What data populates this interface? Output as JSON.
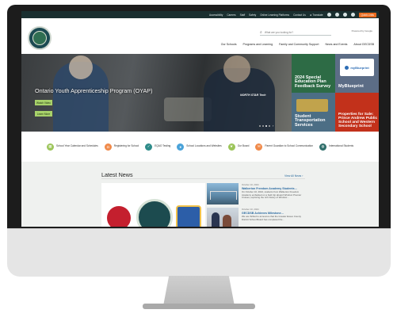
{
  "topbar": {
    "links": [
      "Accessibility",
      "Careers",
      "Staff",
      "Safety",
      "Online Learning Platforms",
      "Contact Us"
    ],
    "translate": "Translate",
    "quick_links": "Quick Links"
  },
  "header": {
    "search_placeholder": "What are you looking for?",
    "translate_by": "Powered by Google",
    "nav": [
      "Our Schools",
      "Programs and Learning",
      "Family and Community Support",
      "News and Events",
      "About GECDSB"
    ]
  },
  "hero": {
    "title": "Ontario Youth Apprenticeship Program (OYAP)",
    "buttons": [
      "Watch Video",
      "Learn More"
    ],
    "brand_text": "NORTH STAR Tech",
    "tiles": [
      {
        "label": "2024 Special Education Plan Feedback Survey",
        "color": "#2d6b45"
      },
      {
        "label": "MyBlueprint",
        "card_text": "myBlueprint",
        "color": "#5c6d86"
      },
      {
        "label": "Student Transportation Services",
        "color": "#4c6e85"
      },
      {
        "label": "Properties for Sale: Prince Andrew Public School and Western Secondary School",
        "color": "#c2311b"
      }
    ]
  },
  "quick_links": [
    {
      "label": "School Year Calendar and Schedules",
      "icon": "calendar-icon",
      "color": "#9cc55a"
    },
    {
      "label": "Registering for School",
      "icon": "backpack-icon",
      "color": "#f08a4a"
    },
    {
      "label": "EQAO Testing",
      "icon": "checklist-icon",
      "color": "#2f8c8a"
    },
    {
      "label": "School Locations and Websites",
      "icon": "map-pin-icon",
      "color": "#4aa3d9"
    },
    {
      "label": "Our Board",
      "icon": "leaf-icon",
      "color": "#9cc55a"
    },
    {
      "label": "Parent Guardian to School Communication",
      "icon": "chat-icon",
      "color": "#f08a4a"
    },
    {
      "label": "International Students",
      "icon": "globe-icon",
      "color": "#2f6e6a"
    }
  ],
  "news": {
    "title": "Latest News",
    "view_all": "View All News",
    "articles": [
      {
        "date": "October 10, 2024",
        "title": "Walkerton Freedom Academy Students…",
        "summary": "On October 10, 2024, students from Walkerton Freedom Academy embarked on a field trip aboard Windsor Premier Cruises, exploring the rich history of Windsor…"
      },
      {
        "date": "October 10, 2024",
        "title": "GECDSB Achieves Milestone…",
        "summary": "We are thrilled to announce that the Greater Essex County District School Board has completed the…"
      }
    ]
  }
}
